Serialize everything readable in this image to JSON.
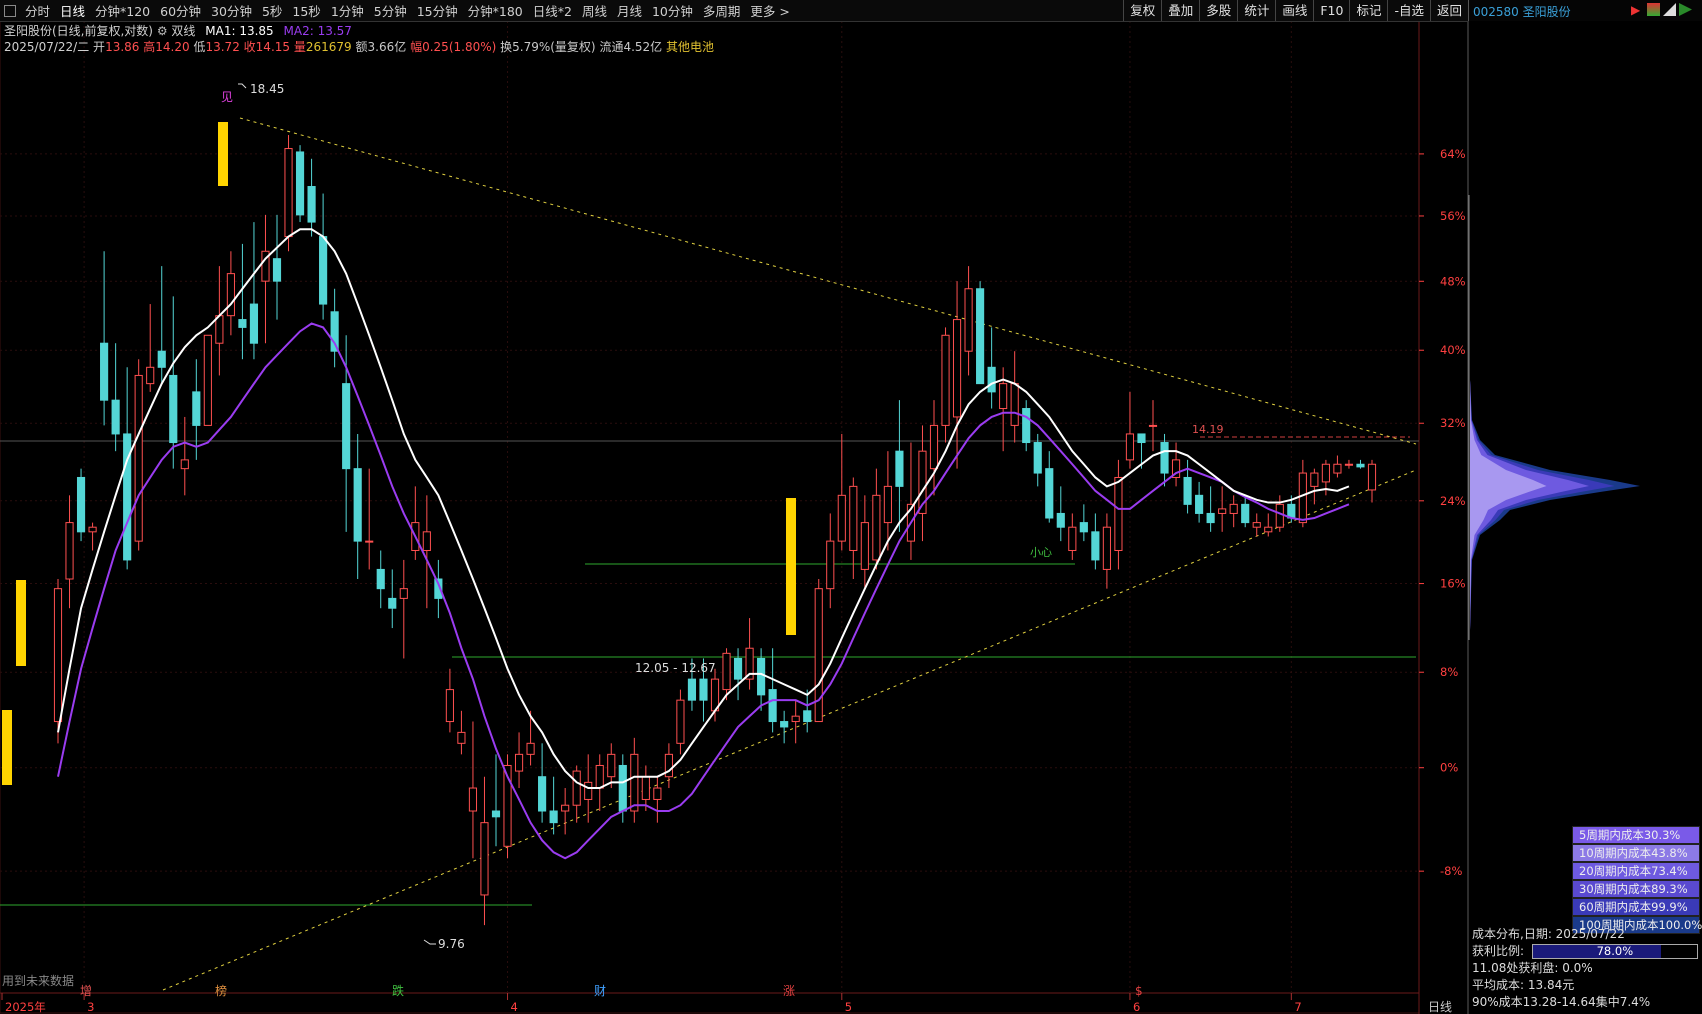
{
  "toolbar": {
    "tabs": [
      "分时",
      "日线",
      "分钟*120",
      "60分钟",
      "30分钟",
      "5秒",
      "15秒",
      "1分钟",
      "5分钟",
      "15分钟",
      "分钟*180",
      "日线*2",
      "周线",
      "月线",
      "10分钟",
      "多周期",
      "更多 >"
    ],
    "active_tab": "日线",
    "buttons": [
      "复权",
      "叠加",
      "多股",
      "统计",
      "画线",
      "F10",
      "标记",
      "-自选",
      "返回"
    ]
  },
  "ticker": {
    "code_name": "002580 圣阳股份"
  },
  "info": {
    "title": "圣阳股份(日线,前复权,对数)",
    "indicator": "双线",
    "ma1": "MA1: 13.85",
    "ma2": "MA2: 13.57",
    "date": "2025/07/22/二",
    "open_label": "开",
    "open": "13.86",
    "high_label": "高",
    "high": "14.20",
    "low_label": "低",
    "low": "13.72",
    "close_label": "收",
    "close": "14.15",
    "vol_label": "量",
    "vol": "261679",
    "amount": "额3.66亿",
    "change_label": "幅",
    "change": "0.25(1.80%)",
    "turnover": "换5.79%(量复权)",
    "float": "流通4.52亿",
    "sector": "其他电池"
  },
  "colors": {
    "up": "#ff5050",
    "down": "#54d6d6",
    "ma1": "#ffffff",
    "ma2": "#9a3cf0",
    "gold": "#ffd400",
    "grid": "#3a1a1a",
    "axis": "#ff4040"
  },
  "annotations": {
    "high_mark": "18.45",
    "low_mark": "9.76",
    "range_label": "12.05 - 12.67",
    "level_label": "14.19",
    "small_text": "小心",
    "jian": "见"
  },
  "y_axis": [
    "64%",
    "56%",
    "48%",
    "40%",
    "32%",
    "24%",
    "16%",
    "8%",
    "0%",
    "-8%"
  ],
  "x_axis": [
    "2025年",
    "3",
    "4",
    "5",
    "6",
    "7"
  ],
  "x_right": "日线",
  "events": [
    "增",
    "榜",
    "跌",
    "财",
    "涨",
    "$"
  ],
  "future_note": "用到未来数据",
  "cost_legend": [
    {
      "label": "5周期内成本30.3%",
      "color": "#7a5ae8"
    },
    {
      "label": "10周期内成本43.8%",
      "color": "#8c7ae6"
    },
    {
      "label": "20周期内成本73.4%",
      "color": "#6e5ae0"
    },
    {
      "label": "30周期内成本89.3%",
      "color": "#5a4ad0"
    },
    {
      "label": "60周期内成本99.9%",
      "color": "#3a3ab8"
    },
    {
      "label": "100周期内成本100.0%",
      "color": "#1a3a8a"
    }
  ],
  "cost_info": {
    "title": "成本分布,日期: 2025/07/22",
    "profit_label": "获利比例:",
    "profit_ratio": "78.0%",
    "profit_value": 0.78,
    "at_price": "11.08处获利盘: 0.0%",
    "avg_cost": "平均成本: 13.84元",
    "concentration": "90%成本13.28-14.64集中7.4%"
  },
  "chart_data": {
    "type": "candlestick",
    "y_scale": "log",
    "ylim": [
      9.3,
      19.6
    ],
    "candles": [
      [
        11.5,
        12.9,
        11.3,
        12.8
      ],
      [
        12.9,
        13.8,
        12.6,
        13.5
      ],
      [
        14.0,
        14.1,
        13.3,
        13.4
      ],
      [
        13.4,
        13.5,
        13.2,
        13.45
      ],
      [
        15.6,
        16.8,
        14.6,
        14.9
      ],
      [
        14.9,
        15.6,
        14.3,
        14.5
      ],
      [
        14.5,
        15.3,
        13.0,
        13.1
      ],
      [
        13.3,
        15.4,
        13.2,
        15.2
      ],
      [
        15.1,
        16.1,
        15.0,
        15.3
      ],
      [
        15.5,
        16.6,
        15.1,
        15.3
      ],
      [
        15.2,
        16.2,
        14.1,
        14.4
      ],
      [
        14.1,
        14.7,
        13.8,
        14.2
      ],
      [
        15.0,
        15.4,
        14.2,
        14.6
      ],
      [
        14.6,
        15.7,
        14.6,
        15.7
      ],
      [
        15.6,
        16.6,
        15.2,
        15.95
      ],
      [
        15.95,
        16.8,
        15.7,
        16.5
      ],
      [
        15.9,
        16.9,
        15.4,
        15.8
      ],
      [
        16.1,
        17.2,
        15.4,
        15.6
      ],
      [
        16.4,
        17.3,
        15.6,
        16.8
      ],
      [
        16.7,
        17.3,
        15.9,
        16.4
      ],
      [
        17.0,
        18.45,
        16.8,
        18.25
      ],
      [
        18.2,
        18.3,
        17.2,
        17.3
      ],
      [
        17.7,
        18.1,
        17.0,
        17.2
      ],
      [
        17.0,
        17.6,
        15.9,
        16.1
      ],
      [
        16.0,
        16.3,
        15.3,
        15.5
      ],
      [
        15.1,
        15.7,
        13.4,
        14.1
      ],
      [
        14.1,
        14.5,
        12.9,
        13.3
      ],
      [
        13.3,
        14.1,
        13.0,
        13.3
      ],
      [
        13.0,
        13.2,
        12.6,
        12.8
      ],
      [
        12.7,
        13.0,
        12.4,
        12.6
      ],
      [
        12.7,
        13.1,
        12.1,
        12.8
      ],
      [
        13.2,
        13.9,
        13.1,
        13.5
      ],
      [
        13.2,
        13.8,
        12.6,
        13.4
      ],
      [
        12.9,
        13.1,
        12.5,
        12.7
      ],
      [
        11.5,
        12.0,
        11.4,
        11.8
      ],
      [
        11.3,
        11.6,
        11.2,
        11.4
      ],
      [
        10.7,
        11.5,
        10.3,
        10.9
      ],
      [
        10.0,
        11.0,
        9.76,
        10.6
      ],
      [
        10.7,
        11.2,
        10.4,
        10.65
      ],
      [
        10.4,
        11.2,
        10.3,
        11.1
      ],
      [
        11.05,
        11.4,
        10.9,
        11.2
      ],
      [
        11.2,
        11.6,
        11.1,
        11.3
      ],
      [
        11.0,
        11.3,
        10.6,
        10.7
      ],
      [
        10.7,
        11.0,
        10.5,
        10.6
      ],
      [
        10.7,
        10.9,
        10.5,
        10.75
      ],
      [
        10.75,
        11.1,
        10.6,
        11.05
      ],
      [
        10.8,
        11.2,
        10.6,
        10.95
      ],
      [
        10.9,
        11.2,
        10.7,
        11.1
      ],
      [
        11.0,
        11.3,
        10.9,
        11.2
      ],
      [
        11.1,
        11.2,
        10.6,
        10.7
      ],
      [
        10.7,
        11.35,
        10.6,
        11.2
      ],
      [
        10.8,
        11.1,
        10.7,
        11.0
      ],
      [
        10.8,
        11.0,
        10.6,
        10.9
      ],
      [
        11.0,
        11.3,
        10.9,
        11.2
      ],
      [
        11.3,
        11.8,
        11.2,
        11.7
      ],
      [
        11.9,
        12.1,
        11.6,
        11.7
      ],
      [
        11.9,
        12.1,
        11.5,
        11.7
      ],
      [
        11.6,
        12.0,
        11.5,
        11.9
      ],
      [
        11.8,
        12.2,
        11.7,
        12.15
      ],
      [
        12.1,
        12.2,
        11.7,
        11.9
      ],
      [
        11.9,
        12.5,
        11.8,
        12.2
      ],
      [
        12.1,
        12.2,
        11.6,
        11.75
      ],
      [
        11.8,
        12.2,
        11.4,
        11.5
      ],
      [
        11.5,
        11.6,
        11.3,
        11.45
      ],
      [
        11.5,
        11.7,
        11.3,
        11.55
      ],
      [
        11.6,
        11.8,
        11.4,
        11.5
      ],
      [
        11.5,
        12.9,
        11.5,
        12.8
      ],
      [
        12.8,
        13.6,
        12.6,
        13.3
      ],
      [
        13.3,
        14.5,
        13.2,
        13.8
      ],
      [
        13.2,
        14.0,
        12.9,
        13.9
      ],
      [
        13.0,
        13.8,
        12.8,
        13.5
      ],
      [
        13.1,
        14.1,
        13.0,
        13.8
      ],
      [
        13.5,
        14.3,
        13.2,
        13.9
      ],
      [
        14.3,
        14.9,
        13.4,
        13.9
      ],
      [
        13.3,
        14.4,
        13.1,
        13.7
      ],
      [
        13.6,
        14.6,
        13.3,
        14.3
      ],
      [
        14.1,
        14.9,
        13.8,
        14.6
      ],
      [
        14.6,
        15.8,
        14.4,
        15.7
      ],
      [
        14.7,
        16.4,
        14.1,
        15.9
      ],
      [
        15.5,
        16.6,
        15.2,
        16.3
      ],
      [
        16.3,
        16.4,
        15.2,
        15.1
      ],
      [
        15.3,
        15.8,
        14.8,
        15.0
      ],
      [
        14.8,
        15.3,
        14.3,
        15.1
      ],
      [
        14.6,
        15.5,
        14.4,
        15.1
      ],
      [
        14.8,
        14.9,
        14.3,
        14.4
      ],
      [
        14.4,
        14.5,
        13.9,
        14.05
      ],
      [
        14.1,
        14.3,
        13.5,
        13.55
      ],
      [
        13.6,
        13.9,
        13.3,
        13.45
      ],
      [
        13.2,
        13.6,
        13.1,
        13.45
      ],
      [
        13.5,
        13.7,
        13.3,
        13.4
      ],
      [
        13.4,
        13.6,
        13.0,
        13.1
      ],
      [
        13.0,
        13.6,
        12.8,
        13.45
      ],
      [
        13.2,
        14.2,
        13.0,
        14.0
      ],
      [
        14.2,
        15.0,
        14.1,
        14.5
      ],
      [
        14.5,
        14.5,
        14.1,
        14.4
      ],
      [
        14.6,
        14.9,
        14.3,
        14.6
      ],
      [
        14.4,
        14.5,
        13.9,
        14.05
      ],
      [
        14.0,
        14.4,
        13.9,
        14.2
      ],
      [
        14.0,
        14.2,
        13.6,
        13.7
      ],
      [
        13.8,
        13.95,
        13.5,
        13.6
      ],
      [
        13.6,
        13.9,
        13.4,
        13.5
      ],
      [
        13.6,
        13.9,
        13.4,
        13.65
      ],
      [
        13.6,
        13.8,
        13.45,
        13.7
      ],
      [
        13.7,
        13.8,
        13.45,
        13.5
      ],
      [
        13.45,
        13.6,
        13.35,
        13.5
      ],
      [
        13.4,
        13.6,
        13.35,
        13.45
      ],
      [
        13.45,
        13.8,
        13.4,
        13.7
      ],
      [
        13.7,
        13.8,
        13.5,
        13.55
      ],
      [
        13.5,
        14.2,
        13.45,
        14.05
      ],
      [
        13.9,
        14.1,
        13.7,
        14.05
      ],
      [
        13.95,
        14.2,
        13.8,
        14.15
      ],
      [
        14.05,
        14.25,
        14.0,
        14.15
      ],
      [
        14.15,
        14.2,
        14.1,
        14.15
      ],
      [
        14.15,
        14.2,
        14.1,
        14.12
      ],
      [
        13.86,
        14.2,
        13.72,
        14.15
      ]
    ],
    "ma1": [
      11.4,
      12.0,
      12.6,
      13.0,
      13.4,
      13.8,
      14.2,
      14.5,
      14.8,
      15.1,
      15.35,
      15.55,
      15.7,
      15.8,
      15.95,
      16.1,
      16.3,
      16.5,
      16.7,
      16.85,
      17.0,
      17.1,
      17.1,
      17.0,
      16.8,
      16.5,
      16.1,
      15.7,
      15.3,
      14.9,
      14.5,
      14.2,
      14.0,
      13.8,
      13.5,
      13.2,
      12.9,
      12.6,
      12.3,
      12.0,
      11.75,
      11.55,
      11.4,
      11.2,
      11.05,
      10.95,
      10.9,
      10.9,
      10.95,
      10.95,
      11.0,
      11.0,
      11.0,
      11.05,
      11.15,
      11.3,
      11.45,
      11.6,
      11.75,
      11.85,
      11.95,
      11.95,
      11.9,
      11.85,
      11.8,
      11.75,
      11.85,
      12.05,
      12.3,
      12.55,
      12.8,
      13.05,
      13.3,
      13.5,
      13.65,
      13.85,
      14.05,
      14.3,
      14.6,
      14.85,
      15.0,
      15.1,
      15.15,
      15.1,
      15.0,
      14.85,
      14.7,
      14.5,
      14.3,
      14.15,
      14.0,
      13.9,
      13.95,
      14.05,
      14.15,
      14.25,
      14.3,
      14.3,
      14.25,
      14.15,
      14.05,
      13.95,
      13.85,
      13.8,
      13.75,
      13.72,
      13.72,
      13.75,
      13.8,
      13.85,
      13.87,
      13.85,
      13.9
    ],
    "ma2": [
      11.0,
      11.5,
      12.0,
      12.4,
      12.8,
      13.2,
      13.5,
      13.8,
      14.0,
      14.2,
      14.35,
      14.4,
      14.35,
      14.4,
      14.55,
      14.7,
      14.9,
      15.1,
      15.3,
      15.45,
      15.6,
      15.75,
      15.85,
      15.8,
      15.6,
      15.3,
      14.95,
      14.6,
      14.25,
      13.9,
      13.6,
      13.35,
      13.1,
      12.85,
      12.55,
      12.2,
      11.9,
      11.55,
      11.25,
      11.0,
      10.8,
      10.6,
      10.45,
      10.35,
      10.3,
      10.35,
      10.45,
      10.55,
      10.65,
      10.7,
      10.75,
      10.75,
      10.7,
      10.7,
      10.75,
      10.85,
      11.0,
      11.15,
      11.3,
      11.45,
      11.55,
      11.65,
      11.7,
      11.7,
      11.7,
      11.65,
      11.7,
      11.85,
      12.05,
      12.3,
      12.55,
      12.8,
      13.05,
      13.3,
      13.5,
      13.7,
      13.85,
      14.05,
      14.25,
      14.45,
      14.6,
      14.7,
      14.75,
      14.75,
      14.7,
      14.6,
      14.45,
      14.3,
      14.15,
      14.0,
      13.85,
      13.75,
      13.65,
      13.65,
      13.75,
      13.85,
      13.95,
      14.05,
      14.1,
      14.05,
      14.0,
      13.95,
      13.85,
      13.78,
      13.72,
      13.65,
      13.6,
      13.55,
      13.53,
      13.55,
      13.6,
      13.65,
      13.7
    ]
  }
}
